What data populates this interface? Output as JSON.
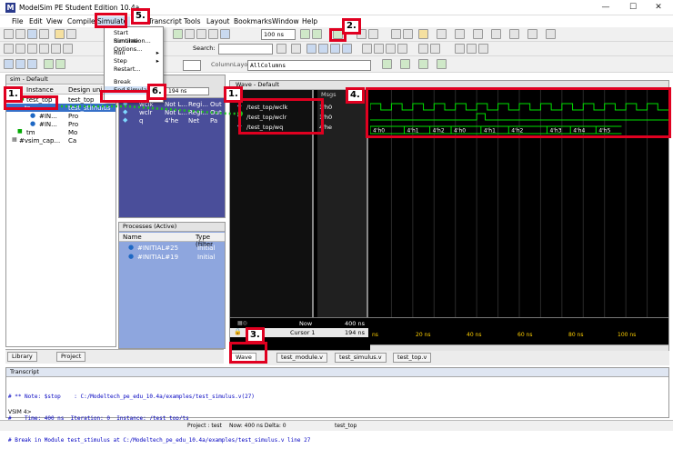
{
  "window": {
    "title": "ModelSim PE Student Edition 10.4a",
    "logo": "M",
    "minimize": "—",
    "maximize": "☐",
    "close": "✕"
  },
  "menu": [
    "File",
    "Edit",
    "View",
    "Compile",
    "Simulate",
    "Transcript",
    "Tools",
    "Layout",
    "Bookmarks",
    "Window",
    "Help"
  ],
  "simulate_menu": {
    "items": [
      "Start Simulation...",
      "Runtime Options...",
      "Run",
      "Step",
      "Restart...",
      "Break",
      "End Simulation"
    ],
    "arrow": "▸"
  },
  "toolbar": {
    "search_label": "Search:",
    "run_length": "100 ns",
    "column_layout_label": "ColumnLayout",
    "column_layout_value": "AllColumns"
  },
  "sim_panel": {
    "title": "sim - Default",
    "columns": [
      "Instance",
      "Design uni"
    ],
    "rows": [
      {
        "instance": "test_top",
        "design": "test_top"
      },
      {
        "instance": "ts",
        "design": "test_stimulus"
      },
      {
        "instance": "#IN...",
        "design": "test_stimulus"
      },
      {
        "instance": "#IN...",
        "design": "test_stimulus"
      },
      {
        "instance": "tm",
        "design": "test_m"
      },
      {
        "instance": "#vsim_cap...",
        "design": "Ca"
      }
    ],
    "design_short": [
      "Pro",
      "Pro",
      "Mo"
    ]
  },
  "objects_panel": {
    "sim_time": "194 ns",
    "rows": [
      {
        "name": "wclk",
        "value": "Not L...",
        "kind": "Regi...",
        "mode": "Out"
      },
      {
        "name": "wclr",
        "value": "Not L...",
        "kind": "Regi...",
        "mode": "Out"
      },
      {
        "name": "q",
        "value": "4'he",
        "kind": "Net",
        "mode": "Pa"
      }
    ]
  },
  "processes_panel": {
    "title": "Processes (Active)",
    "columns": [
      "Name",
      "Type (filter"
    ],
    "rows": [
      {
        "name": "#INITIAL#25",
        "type": "Initial"
      },
      {
        "name": "#INITIAL#19",
        "type": "Initial"
      }
    ]
  },
  "wave_panel": {
    "title": "Wave - Default",
    "msgs_label": "Msgs",
    "signals": [
      {
        "name": "/test_top/wclk",
        "value": "1'h0"
      },
      {
        "name": "/test_top/wclr",
        "value": "1'h0"
      },
      {
        "name": "/test_top/wq",
        "value": "4'he"
      }
    ],
    "bus_values": [
      "4'h0",
      "4'h1",
      "4'h2",
      "4'h0",
      "4'h1",
      "4'h2",
      "4'h3",
      "4'h4",
      "4'h5"
    ],
    "now_label": "Now",
    "now_value": "400 ns",
    "cursor_label": "Cursor 1",
    "cursor_value": "194 ns",
    "ticks": [
      "ns",
      "20 ns",
      "40 ns",
      "60 ns",
      "80 ns",
      "100 ns"
    ]
  },
  "left_tabs": [
    "Library",
    "Project"
  ],
  "bottom_tabs": [
    "Wave",
    "test_module.v",
    "test_simulus.v",
    "test_top.v"
  ],
  "transcript": {
    "title": "Transcript",
    "lines": [
      "# ** Note: $stop    : C:/Modeltech_pe_edu_10.4a/examples/test_simulus.v(27)",
      "#    Time: 400 ns  Iteration: 0  Instance: /test_top/ts",
      "# Break in Module test_stimulus at C:/Modeltech_pe_edu_10.4a/examples/test_simulus.v line 27"
    ],
    "prompt": "VSIM 4>"
  },
  "statusbar": {
    "project": "Project : test",
    "now": "Now: 400 ns  Delta: 0",
    "context": "test_top"
  },
  "annotations": [
    "1.",
    "1.",
    "2.",
    "3.",
    "4.",
    "5.",
    "6."
  ],
  "colors": {
    "wave_bg": "#000000",
    "wave_signal": "#00e000",
    "annotation": "#e00020",
    "objects_bg": "#4a4e9a",
    "processes_bg": "#8ea6de"
  }
}
